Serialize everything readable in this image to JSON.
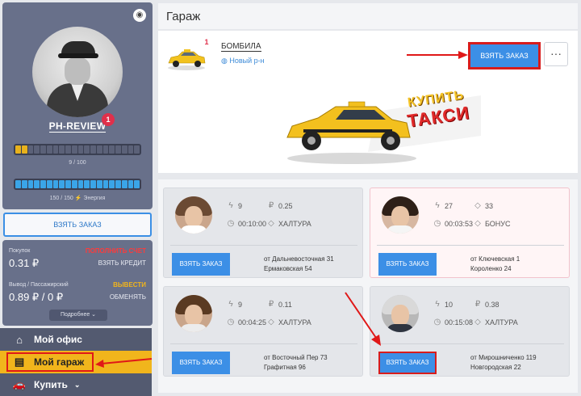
{
  "sidebar": {
    "username": "PH-REVIEW",
    "notifications": "1",
    "gold_bar": {
      "fill": 0.1,
      "text": "9 / 100"
    },
    "energy_bar": {
      "fill": 1.0,
      "text": "150 / 150 ⚡ Энергия"
    },
    "take_order_label": "ВЗЯТЬ ЗАКАЗ",
    "stats": {
      "purchases_label": "Покупок",
      "purchases_value": "0.31 ₽",
      "top_up_label": "ПОПОЛНИТЬ СЧЕТ",
      "credit_label": "ВЗЯТЬ КРЕДИТ",
      "withdraw_label": "Вывод / Пассажирский",
      "withdraw_value": "0.89 ₽ / 0 ₽",
      "withdraw_link": "ВЫВЕСТИ",
      "exchange_link": "ОБМЕНЯТЬ",
      "more_label": "Подробнее ⌄"
    },
    "menu": {
      "office": "Мой офис",
      "garage": "Мой гараж",
      "buy": "Купить"
    }
  },
  "garage": {
    "title": "Гараж",
    "car_name": "БОМБИЛА",
    "car_status": "Новый р-н",
    "car_badge": "1",
    "take_order_label": "ВЗЯТЬ ЗАКАЗ",
    "more_dots": "···",
    "banner_line1": "КУПИТЬ",
    "banner_line2": "ТАКСИ"
  },
  "orders": [
    {
      "energy": "9",
      "money": "0.25",
      "time": "00:10:00",
      "type": "ХАЛТУРА",
      "button": "ВЗЯТЬ ЗАКАЗ",
      "from": "от Дальневосточная 31",
      "to": "Ермаковская 54"
    },
    {
      "energy": "27",
      "money": "33",
      "time": "00:03:53",
      "type": "БОНУС",
      "button": "ВЗЯТЬ ЗАКАЗ",
      "from": "от Ключевская 1",
      "to": "Короленко 24"
    },
    {
      "energy": "9",
      "money": "0.11",
      "time": "00:04:25",
      "type": "ХАЛТУРА",
      "button": "ВЗЯТЬ ЗАКАЗ",
      "from": "от Восточный Пер 73",
      "to": "Графитная 96"
    },
    {
      "energy": "10",
      "money": "0.38",
      "time": "00:15:08",
      "type": "ХАЛТУРА",
      "button": "ВЗЯТЬ ЗАКАЗ",
      "from": "от Мирошниченко 119",
      "to": "Новгородская 22"
    }
  ],
  "icons": {
    "camera": "camera-icon",
    "energy": "lightning-icon",
    "money": "ruble-icon",
    "time": "clock-icon",
    "type": "diamond-icon",
    "globe": "globe-icon"
  },
  "colors": {
    "accent_blue": "#3c8fe6",
    "highlight_red": "#d81c1c",
    "garage_yellow": "#f1b51c",
    "sidebar_panel": "#68708a"
  }
}
